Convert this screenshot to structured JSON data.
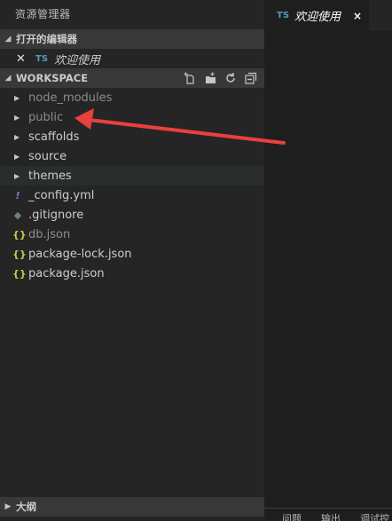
{
  "sidebar": {
    "title": "资源管理器",
    "open_editors": {
      "header": "打开的编辑器",
      "items": [
        {
          "badge": "TS",
          "name": "欢迎使用"
        }
      ]
    },
    "workspace": {
      "header": "WORKSPACE",
      "actions": [
        "new-file-icon",
        "new-folder-icon",
        "refresh-icon",
        "collapse-all-icon"
      ],
      "tree": [
        {
          "type": "folder",
          "name": "node_modules",
          "dim": true
        },
        {
          "type": "folder",
          "name": "public",
          "dim": true
        },
        {
          "type": "folder",
          "name": "scaffolds",
          "dim": false
        },
        {
          "type": "folder",
          "name": "source",
          "dim": false
        },
        {
          "type": "folder",
          "name": "themes",
          "dim": false,
          "selected": true
        },
        {
          "type": "file",
          "icon": "!",
          "icon_name": "yaml-icon",
          "name": "_config.yml",
          "dim": false
        },
        {
          "type": "file",
          "icon": "◆",
          "icon_name": "git-icon",
          "name": ".gitignore",
          "dim": false
        },
        {
          "type": "file",
          "icon": "{}",
          "icon_name": "json-icon",
          "name": "db.json",
          "dim": true
        },
        {
          "type": "file",
          "icon": "{}",
          "icon_name": "json-icon",
          "name": "package-lock.json",
          "dim": false
        },
        {
          "type": "file",
          "icon": "{}",
          "icon_name": "json-icon",
          "name": "package.json",
          "dim": false
        }
      ]
    },
    "outline": {
      "header": "大纲"
    }
  },
  "editor": {
    "active_tab": {
      "badge": "TS",
      "name": "欢迎使用",
      "close": "×"
    }
  },
  "panel": {
    "tabs": [
      "问题",
      "输出",
      "调试控"
    ]
  },
  "colors": {
    "sidebar_bg": "#252526",
    "editor_bg": "#1e1e1e",
    "ts_badge": "#519aba",
    "json_icon": "#cbcb41",
    "annotation_arrow": "#e8413c"
  }
}
